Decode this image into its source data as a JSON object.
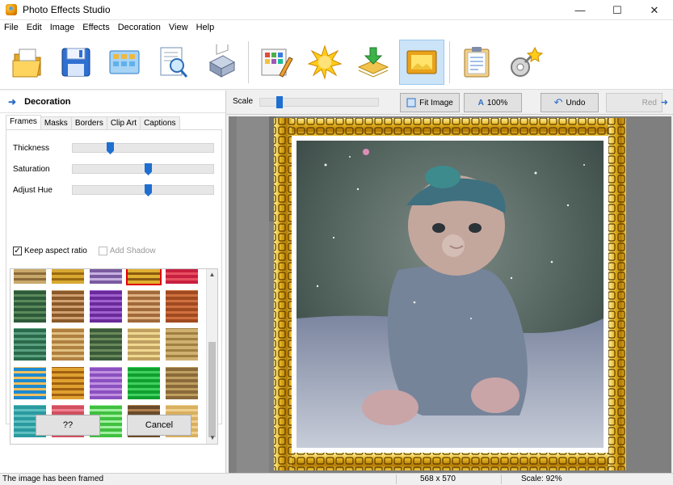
{
  "window": {
    "title": "Photo Effects Studio",
    "controls": [
      "—",
      "☐",
      "✕"
    ]
  },
  "menu": [
    "File",
    "Edit",
    "Image",
    "Effects",
    "Decoration",
    "View",
    "Help"
  ],
  "toolbar": {
    "buttons": [
      {
        "icon": "open-folder-icon"
      },
      {
        "icon": "save-disk-icon"
      },
      {
        "icon": "gallery-grid-icon"
      },
      {
        "icon": "preview-magnifier-icon"
      },
      {
        "icon": "printer-icon"
      },
      {
        "icon": "palette-edit-icon"
      },
      {
        "icon": "sun-effects-icon"
      },
      {
        "icon": "layers-download-icon"
      },
      {
        "icon": "frame-picture-icon",
        "active": true
      },
      {
        "icon": "clipboard-icon"
      },
      {
        "icon": "settings-gear-icon"
      }
    ]
  },
  "panel": {
    "header": "Decoration",
    "tabs": [
      "Frames",
      "Masks",
      "Borders",
      "Clip Art",
      "Captions"
    ],
    "active_tab": "Frames",
    "sliders": [
      {
        "label": "Thickness",
        "value": 0.25
      },
      {
        "label": "Saturation",
        "value": 0.53
      },
      {
        "label": "Adjust Hue",
        "value": 0.53
      }
    ],
    "keep_aspect": {
      "label": "Keep aspect ratio",
      "checked": true
    },
    "add_shadow": {
      "label": "Add Shadow",
      "checked": false,
      "disabled": true
    },
    "frames_selected_index": 3,
    "buttons": {
      "help": "??",
      "cancel": "Cancel"
    }
  },
  "view_bar": {
    "scale_label": "Scale",
    "scale_value": 0.14,
    "fit_label": "Fit Image",
    "zoom_label": "100%",
    "undo_label": "Undo",
    "redo_label": "Red"
  },
  "status": {
    "message": "The image has been framed",
    "dimensions": "568 x 570",
    "scale": "Scale: 92%"
  },
  "colors": {
    "accent": "#1e6fd0",
    "frame_gold": "#d8a418",
    "selection": "#e00000"
  }
}
